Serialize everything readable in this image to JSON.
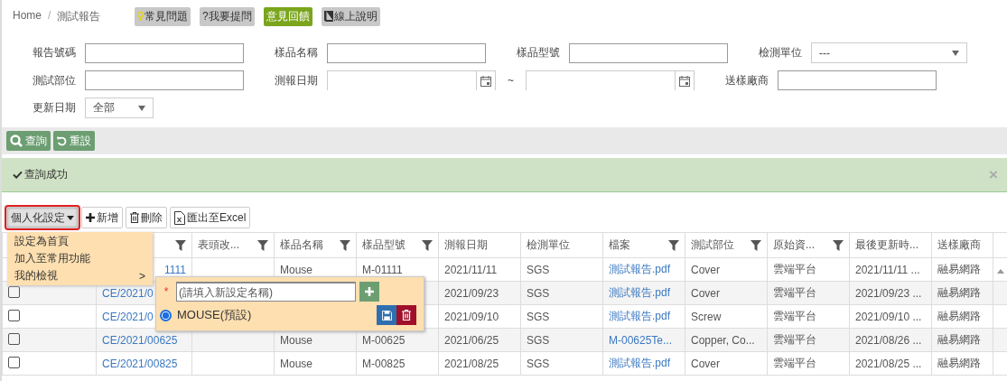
{
  "breadcrumb": {
    "separator": "/",
    "items": [
      {
        "label": "Home"
      },
      {
        "label": "測試報告"
      }
    ]
  },
  "help_buttons": [
    {
      "kind": "faq",
      "label": "常見問題",
      "color": "#c8c8c8"
    },
    {
      "kind": "ask",
      "label": "?我要提問",
      "color": "#c8c8c8"
    },
    {
      "kind": "feedback",
      "label": "意見回饋",
      "color": "#7aa51c"
    },
    {
      "kind": "manual",
      "label": "線上說明",
      "color": "#c8c8c8"
    }
  ],
  "filters": {
    "rows": [
      [
        {
          "kind": "text",
          "label": "報告號碼"
        },
        {
          "kind": "text",
          "label": "樣品名稱"
        },
        {
          "kind": "text",
          "label": "樣品型號"
        },
        {
          "kind": "select",
          "label": "檢測單位",
          "value": "---"
        }
      ],
      [
        {
          "kind": "text",
          "label": "測試部位"
        },
        {
          "kind": "daterange",
          "label": "測報日期",
          "separator": "~"
        },
        {
          "kind": "text",
          "label": "送樣廠商"
        }
      ],
      [
        {
          "kind": "smallselect",
          "label": "更新日期",
          "value": "全部"
        }
      ]
    ]
  },
  "search_buttons": [
    {
      "kind": "search",
      "label": "查詢"
    },
    {
      "kind": "reset",
      "label": "重設"
    }
  ],
  "message": {
    "text": "查詢成功",
    "close": "×"
  },
  "toolbar": [
    {
      "kind": "menu",
      "label": "個人化設定",
      "expanded": true
    },
    {
      "kind": "add",
      "label": "新增"
    },
    {
      "kind": "delete",
      "label": "刪除"
    },
    {
      "kind": "excel",
      "label": "匯出至Excel"
    }
  ],
  "menu": {
    "items": [
      {
        "label": "設定為首頁"
      },
      {
        "label": "加入至常用功能"
      },
      {
        "label": "我的檢視",
        "submenu": ">"
      }
    ]
  },
  "views_popup": {
    "required_mark": "*",
    "placeholder": "(請填入新設定名稱)",
    "views": [
      {
        "label": "MOUSE(預設)",
        "selected": true
      }
    ]
  },
  "table": {
    "columns": [
      {
        "kind": "link",
        "filter": true
      },
      {
        "label": "表頭改...",
        "filter": true
      },
      {
        "kind": "text",
        "label": "樣品名稱",
        "filter": true
      },
      {
        "kind": "text",
        "label": "樣品型號",
        "filter": true
      },
      {
        "kind": "text",
        "label": "測報日期",
        "filter": false
      },
      {
        "kind": "text",
        "label": "檢測單位",
        "filter": false
      },
      {
        "kind": "link",
        "label": "檔案",
        "filter": true
      },
      {
        "kind": "text",
        "label": "測試部位",
        "filter": true
      },
      {
        "kind": "text",
        "label": "原始資...",
        "filter": true
      },
      {
        "kind": "text",
        "label": "最後更新時...",
        "filter": false
      },
      {
        "kind": "text",
        "label": "送樣廠商",
        "filter": false
      }
    ],
    "rows": [
      {
        "cells": [
          "1111",
          null,
          "Mouse",
          "M-01111",
          "2021/11/11",
          "SGS",
          "測試報告.pdf",
          "Cover",
          "雲端平台",
          "2021/11/11 ...",
          "融易網路"
        ]
      },
      {
        "checked": false,
        "cells": [
          "CE/2021/0",
          null,
          null,
          null,
          "2021/09/23",
          "SGS",
          "測試報告.pdf",
          "Cover",
          "雲端平台",
          "2021/09/23 ...",
          "融易網路"
        ]
      },
      {
        "checked": false,
        "cells": [
          "CE/2021/0",
          null,
          null,
          null,
          "2021/09/10",
          "SGS",
          "測試報告.pdf",
          "Screw",
          "雲端平台",
          "2021/09/10 ...",
          "融易網路"
        ]
      },
      {
        "checked": false,
        "cells": [
          "CE/2021/00625",
          null,
          "Mouse",
          "M-00625",
          "2021/06/25",
          "SGS",
          "M-00625Te...",
          "Copper, Co...",
          "雲端平台",
          "2021/08/26 ...",
          "融易網路"
        ]
      },
      {
        "checked": false,
        "cells": [
          "CE/2021/00825",
          null,
          "Mouse",
          "M-00825",
          "2021/08/25",
          "SGS",
          "測試報告.pdf",
          "Cover",
          "雲端平台",
          "2021/08/25 ...",
          "融易網路"
        ]
      }
    ]
  }
}
